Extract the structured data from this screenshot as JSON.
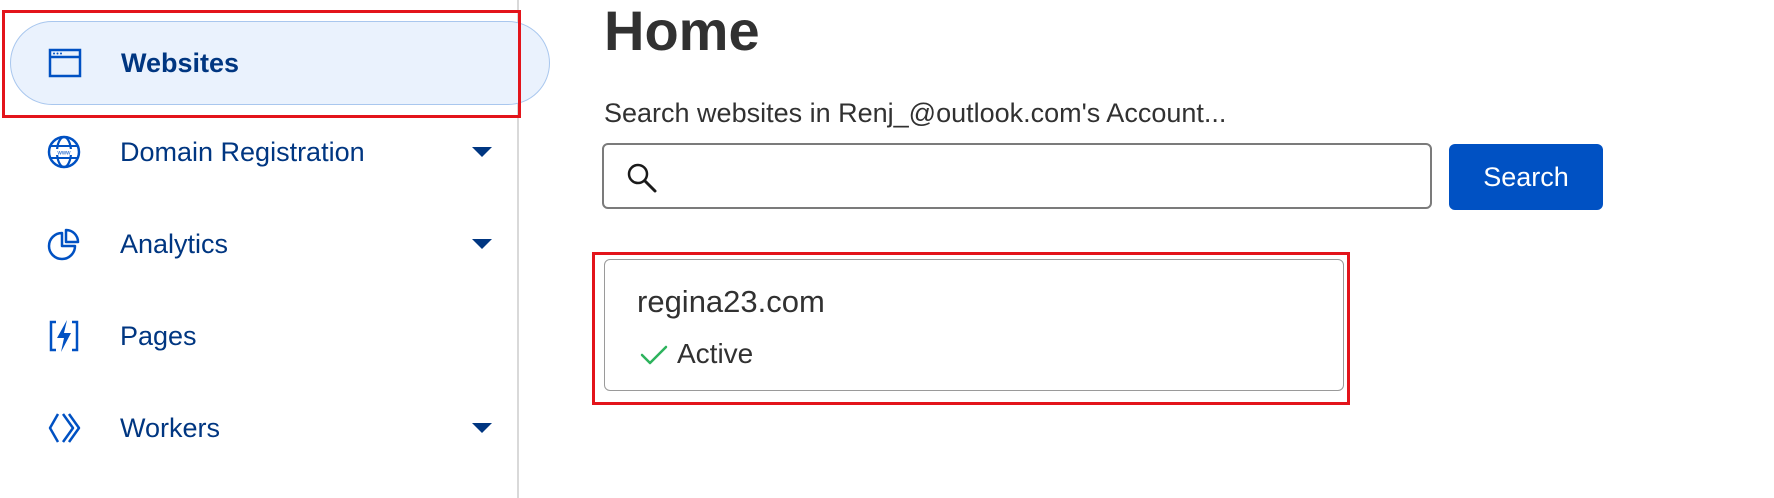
{
  "sidebar": {
    "items": [
      {
        "label": "Websites",
        "icon": "browser-window-icon",
        "active": true,
        "has_dropdown": false
      },
      {
        "label": "Domain Registration",
        "icon": "globe-www-icon",
        "active": false,
        "has_dropdown": true
      },
      {
        "label": "Analytics",
        "icon": "pie-chart-icon",
        "active": false,
        "has_dropdown": true
      },
      {
        "label": "Pages",
        "icon": "lightning-page-icon",
        "active": false,
        "has_dropdown": false
      },
      {
        "label": "Workers",
        "icon": "workers-chevrons-icon",
        "active": false,
        "has_dropdown": true
      }
    ]
  },
  "main": {
    "title": "Home",
    "search": {
      "label": "Search websites in Renj_@outlook.com's Account...",
      "value": "",
      "button_label": "Search"
    },
    "site": {
      "domain": "regina23.com",
      "status": "Active"
    }
  },
  "colors": {
    "accent": "#0051c3",
    "nav_text": "#003681",
    "active_bg": "#eaf2fd",
    "highlight": "#e3141b",
    "status_ok": "#2db35d"
  }
}
